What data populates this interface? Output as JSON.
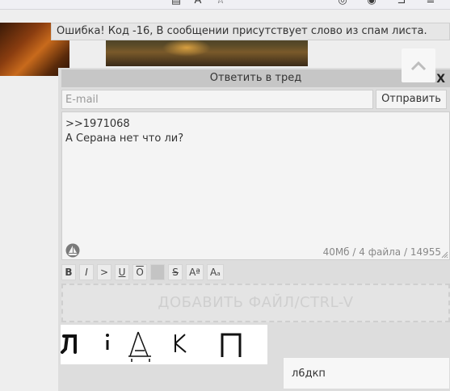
{
  "browser": {
    "icons": [
      "reader-view-icon",
      "translate-icon",
      "bookmark-star-icon",
      "pocket-icon",
      "account-icon",
      "extensions-icon",
      "menu-icon"
    ]
  },
  "error": {
    "message": "Ошибка! Код -16, В сообщении присутствует слово из спам листа."
  },
  "reply": {
    "title": "Ответить в тред",
    "close_label": "X",
    "email_placeholder": "E-mail",
    "send_label": "Отправить",
    "message": ">>1971068\nА Серана нет что ли?",
    "file_limits": "40Мб / 4 файла / 14955",
    "toolbar": {
      "bold": "B",
      "italic": "I",
      "quote": ">",
      "underline": "U",
      "overline": "O",
      "spoiler": "",
      "strike": "S",
      "sup": "Aª",
      "sub": "Aₐ"
    },
    "dropzone_label": "ДОБАВИТЬ ФАЙЛ/CTRL-V",
    "captcha_value": "л6дкп"
  },
  "colors": {
    "form_bg": "#dddddd",
    "header_bg": "#c6c6c6",
    "input_bg": "#f4f4f4"
  }
}
